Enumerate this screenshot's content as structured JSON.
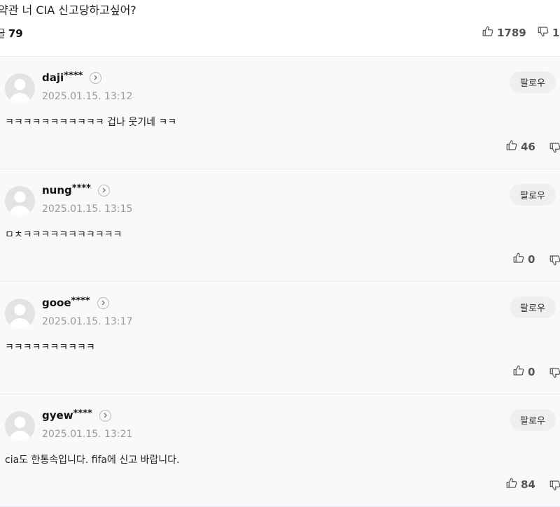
{
  "post": {
    "title_fragment": "약관 너 CIA 신고당하고싶어?",
    "comment_count_label": "글",
    "comment_count": "79",
    "likes": "1789",
    "dislikes_partial": "1"
  },
  "follow_label": "팔로우",
  "comments": [
    {
      "username": "daji",
      "mask": "****",
      "date": "2025.01.15. 13:12",
      "text": "ㅋㅋㅋㅋㅋㅋㅋㅋㅋㅋㅋ 겁나 웃기네 ㅋㅋ",
      "likes": "46"
    },
    {
      "username": "nung",
      "mask": "****",
      "date": "2025.01.15. 13:15",
      "text": "ㅁㅊㅋㅋㅋㅋㅋㅋㅋㅋㅋㅋㅋ",
      "likes": "0"
    },
    {
      "username": "gooe",
      "mask": "****",
      "date": "2025.01.15. 13:17",
      "text": "ㅋㅋㅋㅋㅋㅋㅋㅋㅋㅋ",
      "likes": "0"
    },
    {
      "username": "gyew",
      "mask": "****",
      "date": "2025.01.15. 13:21",
      "text": "cia도 한통속입니다. fifa에 신고 바랍니다.",
      "likes": "84"
    }
  ],
  "icons": {
    "like": "thumbs-up-icon",
    "dislike": "thumbs-down-icon",
    "chevron": "chevron-right-icon",
    "avatar": "default-avatar-icon"
  },
  "colors": {
    "comment_bg": "#f8f9fb",
    "follow_bg": "#efefef",
    "date": "#9a9a9a"
  }
}
